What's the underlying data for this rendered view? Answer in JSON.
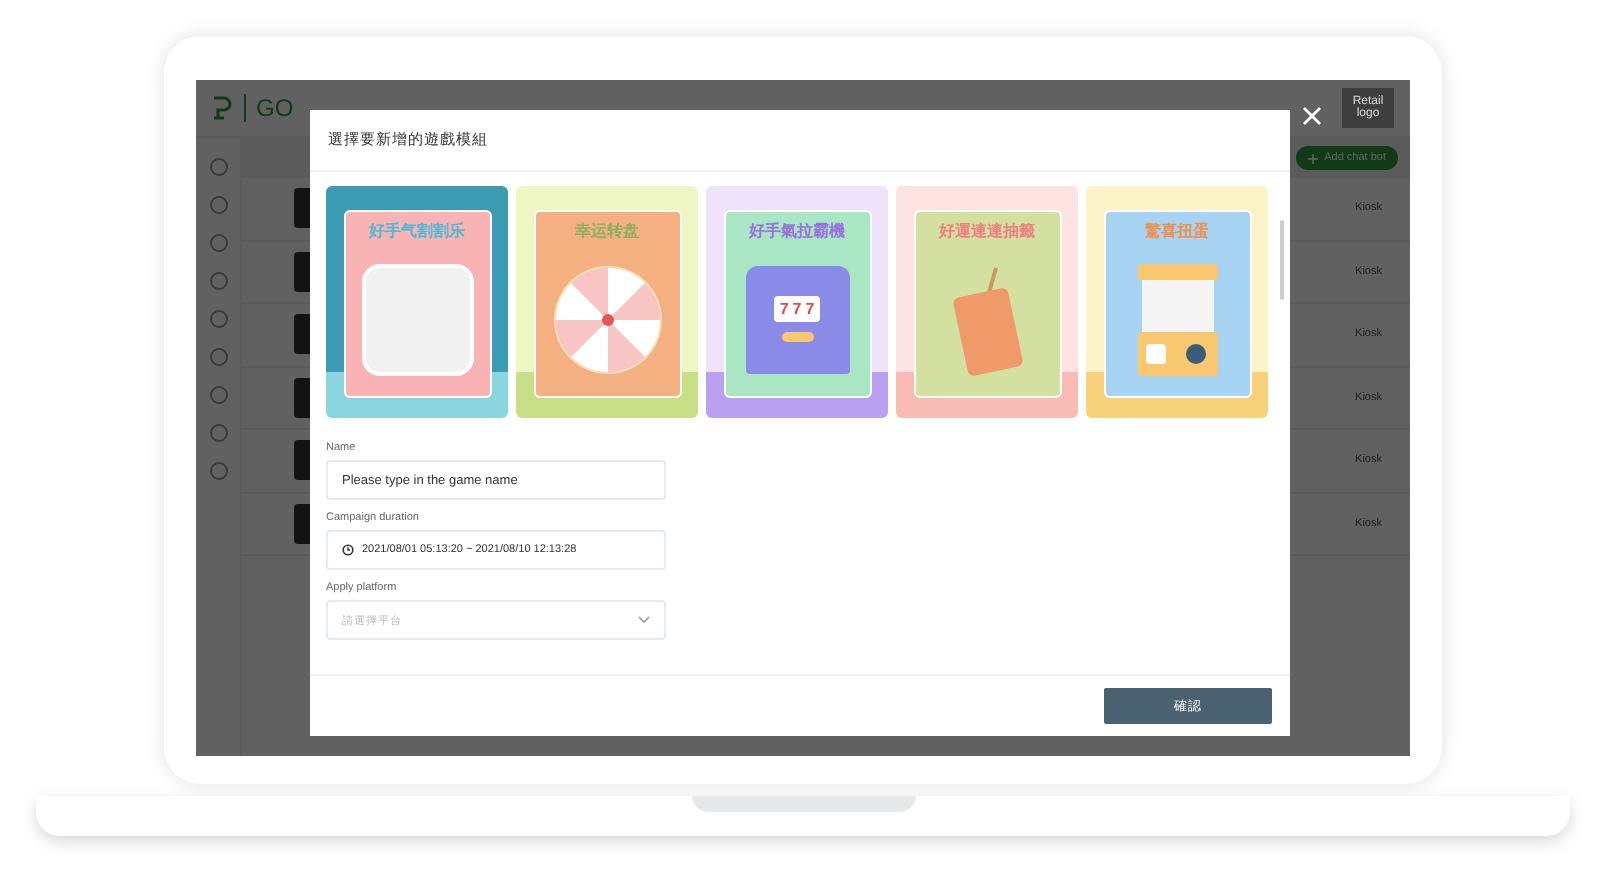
{
  "background_app": {
    "logo_text": "GO",
    "retail_logo": "Retail logo",
    "add_button": "Add chat bot",
    "rows": [
      {
        "type": "Kiosk"
      },
      {
        "type": "Kiosk"
      },
      {
        "type": "Kiosk"
      },
      {
        "type": "Kiosk"
      },
      {
        "type": "Kiosk"
      },
      {
        "type": "Kiosk"
      }
    ]
  },
  "modal": {
    "title": "選擇要新增的遊戲模組",
    "templates": [
      {
        "title": "好手气割割乐",
        "kind": "scratch"
      },
      {
        "title": "幸运转盘",
        "kind": "wheel"
      },
      {
        "title": "好手氣拉霸機",
        "kind": "slot",
        "reels": "777"
      },
      {
        "title": "好運連連抽籤",
        "kind": "draw"
      },
      {
        "title": "驚喜扭蛋",
        "kind": "capsule"
      }
    ],
    "fields": [
      {
        "label": "Name",
        "kind": "text",
        "placeholder": "Please type in the game name"
      },
      {
        "label": "Campaign duration",
        "kind": "range",
        "value": "2021/08/01 05:13:20  ~  2021/08/10 12:13:28"
      },
      {
        "label": "Apply platform",
        "kind": "select",
        "placeholder": "請選擇平台"
      }
    ],
    "confirm_button": "確認"
  }
}
